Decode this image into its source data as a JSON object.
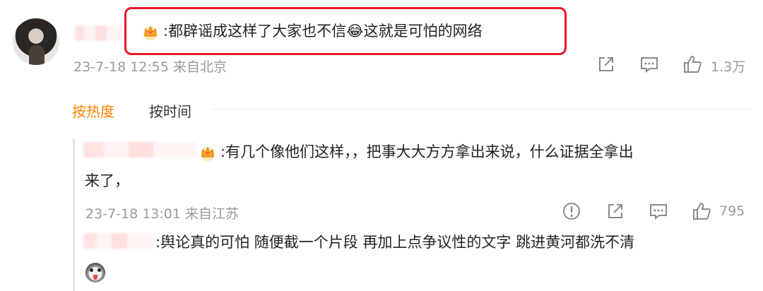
{
  "comment": {
    "text_before": ":都辟谣成这样了大家也不信",
    "laugh_emoji": "😂",
    "text_after": "这就是可怕的网络",
    "meta": "23-7-18 12:55 来自北京",
    "like_count": "1.3万",
    "icons": [
      "share-icon",
      "comment-icon",
      "like-icon"
    ]
  },
  "sort_tabs": {
    "hot": "按热度",
    "time": "按时间",
    "active_color": "#ff8200"
  },
  "replies": [
    {
      "line1": ":有几个像他们这样，，把事大大方方拿出来说，什么证据全拿出",
      "line2": "来了，",
      "meta": "23-7-18 13:01 来自江苏",
      "like_count": "795",
      "icons": [
        "report-icon",
        "share-icon",
        "comment-icon",
        "like-icon"
      ]
    },
    {
      "text": ":舆论真的可怕 随便截一个片段 再加上点争议性的文字 跳进黄河都洗不清",
      "emoji": "husky-emoji-icon"
    }
  ],
  "colors": {
    "highlight": "#e8192c",
    "meta_gray": "#9a9a9a",
    "crown_gold": "#f5a623"
  }
}
